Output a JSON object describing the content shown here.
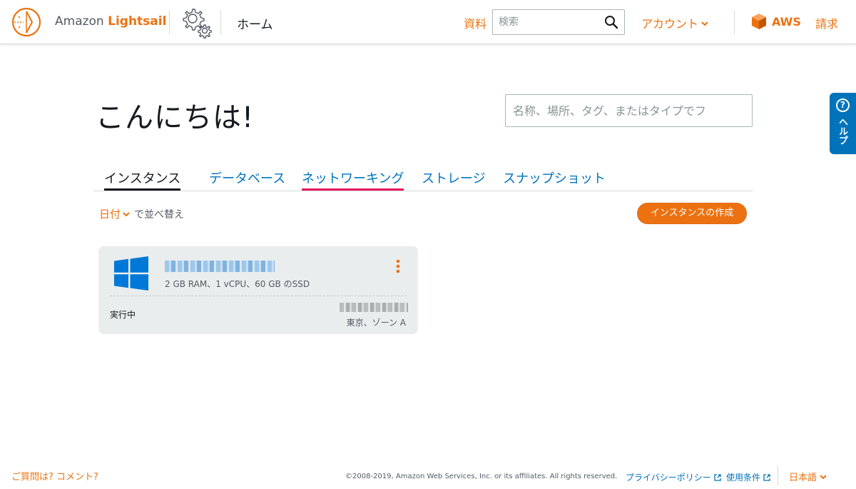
{
  "header": {
    "brand_prefix": "Amazon ",
    "brand_name": "Lightsail",
    "home_label": "ホーム",
    "docs_label": "資料",
    "search_placeholder": "検索",
    "account_label": "アカウント",
    "aws_label": "AWS",
    "billing_label": "請求",
    "icons": {
      "logo": "lightsail-logo-icon",
      "settings": "gear-icon",
      "search": "search-icon",
      "aws": "aws-cube-icon"
    }
  },
  "help": {
    "label": "ヘルプ",
    "icon": "question-icon"
  },
  "main": {
    "greeting": "こんにちは!",
    "search_placeholder": "名称、場所、タグ、またはタイプでフ",
    "tabs": [
      {
        "label": "インスタンス",
        "state": "active"
      },
      {
        "label": "データベース"
      },
      {
        "label": "ネットワーキング",
        "state": "highlighted"
      },
      {
        "label": "ストレージ"
      },
      {
        "label": "スナップショット"
      }
    ],
    "sort_key": "日付",
    "sort_suffix": "で並べ替え",
    "create_button": "インスタンスの作成"
  },
  "instance": {
    "os_icon": "windows-logo-icon",
    "spec": "2 GB RAM、1 vCPU、60 GB のSSD",
    "status": "実行中",
    "region": "東京、ゾーン A",
    "name_redacted": true,
    "ip_redacted": true
  },
  "footer": {
    "feedback": "ご質問は? コメント?",
    "copyright": "©2008-2019, Amazon Web Services, Inc. or its affiliates. All rights reserved.",
    "privacy": "プライバシーポリシー",
    "terms": "使用条件",
    "language": "日本語"
  },
  "colors": {
    "accent": "#ec7211",
    "link": "#0073bb",
    "highlight": "#e4175a",
    "windows": "#0078d7"
  }
}
